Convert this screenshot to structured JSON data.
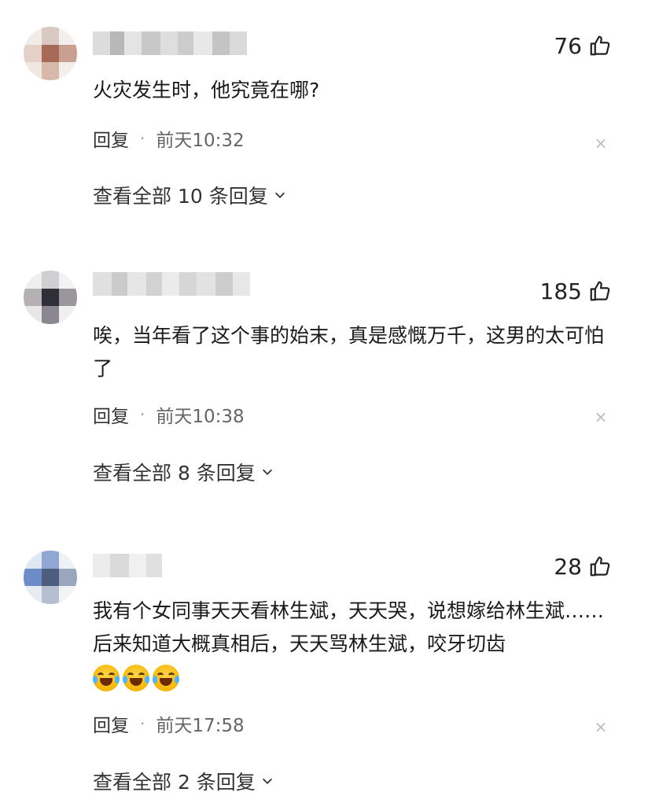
{
  "comments": [
    {
      "likes": "76",
      "text": "火灾发生时，他究竟在哪?",
      "reply_label": "回复",
      "dot": "·",
      "time": "前天10:32",
      "close": "×",
      "view_all": "查看全部 10 条回复"
    },
    {
      "likes": "185",
      "text": "唉，当年看了这个事的始末，真是感慨万千，这男的太可怕了",
      "reply_label": "回复",
      "dot": "·",
      "time": "前天10:38",
      "close": "×",
      "view_all": "查看全部 8 条回复"
    },
    {
      "likes": "28",
      "text": "我有个女同事天天看林生斌，天天哭，说想嫁给林生斌……后来知道大概真相后，天天骂林生斌，咬牙切齿",
      "emojis": [
        "laugh-cry-emoji",
        "laugh-cry-emoji",
        "laugh-cry-emoji"
      ],
      "reply_label": "回复",
      "dot": "·",
      "time": "前天17:58",
      "close": "×",
      "view_all": "查看全部 2 条回复"
    }
  ],
  "icons": {
    "like": "thumbs-up-icon",
    "chevron": "chevron-down-icon",
    "close": "close-icon"
  },
  "colors": {
    "text": "#1a1a1a",
    "meta": "#666666",
    "close": "#bbbbbb"
  }
}
